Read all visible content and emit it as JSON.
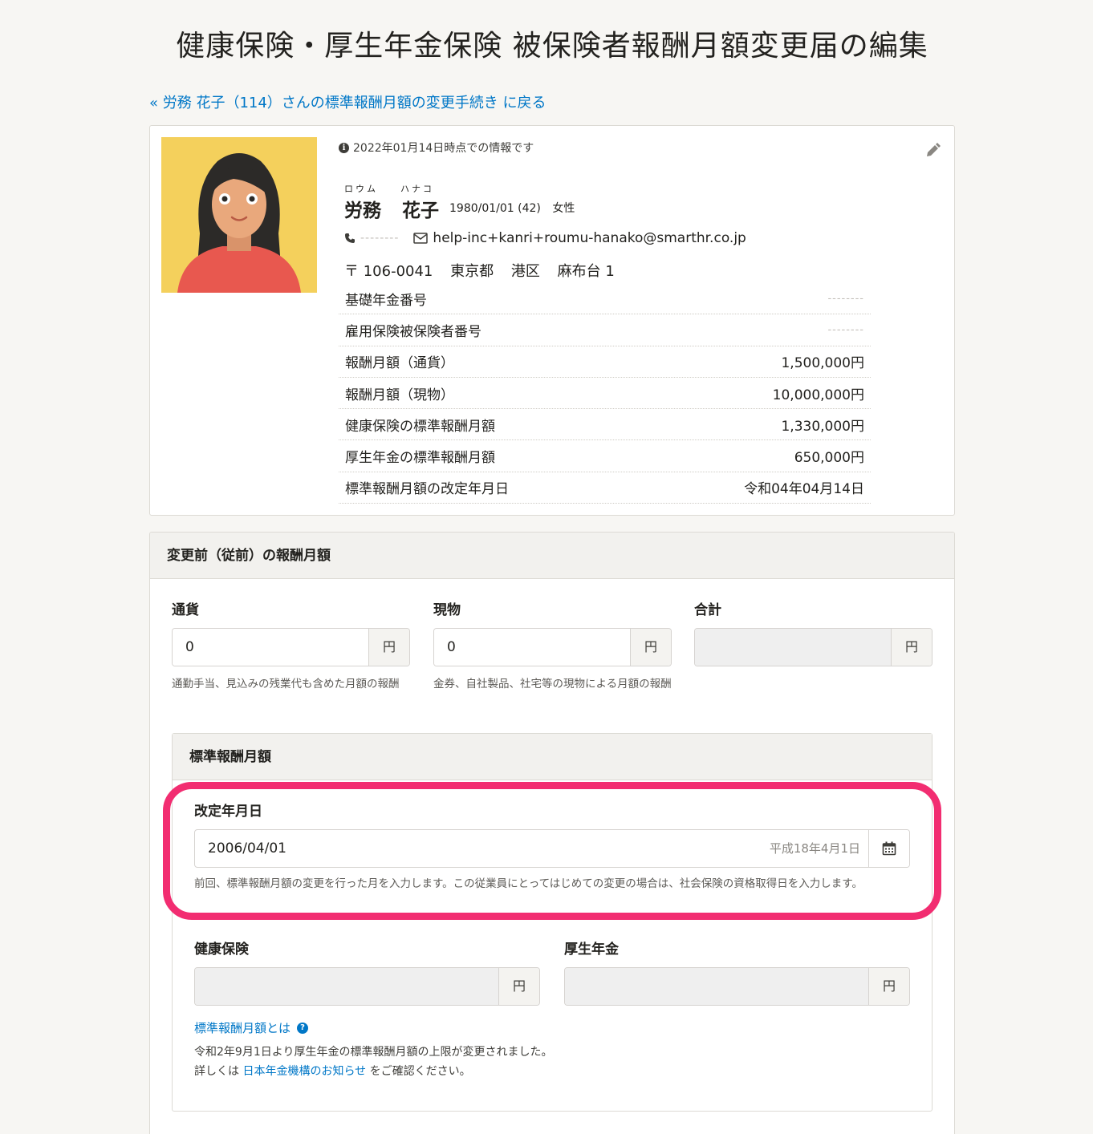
{
  "page_title": "健康保険・厚生年金保険 被保険者報酬月額変更届の編集",
  "back_link": "« 労務 花子（114）さんの標準報酬月額の変更手続き に戻る",
  "profile": {
    "info_note": "2022年01月14日時点での情報です",
    "kana_last": "ロウム",
    "kana_first": "ハナコ",
    "last_name": "労務",
    "first_name": "花子",
    "birth": "1980/01/01 (42)",
    "gender": "女性",
    "phone": "--------",
    "email": "help-inc+kanri+roumu-hanako@smarthr.co.jp",
    "postal": "〒 106-0041",
    "prefecture": "東京都",
    "city": "港区",
    "street": "麻布台 1",
    "rows": [
      {
        "label": "基礎年金番号",
        "value": "--------"
      },
      {
        "label": "雇用保険被保険者番号",
        "value": "--------"
      },
      {
        "label": "報酬月額（通貨）",
        "value": "1,500,000円"
      },
      {
        "label": "報酬月額（現物）",
        "value": "10,000,000円"
      },
      {
        "label": "健康保険の標準報酬月額",
        "value": "1,330,000円"
      },
      {
        "label": "厚生年金の標準報酬月額",
        "value": "650,000円"
      },
      {
        "label": "標準報酬月額の改定年月日",
        "value": "令和04年04月14日"
      }
    ]
  },
  "before_panel": {
    "title": "変更前（従前）の報酬月額",
    "currency_label": "通貨",
    "currency_value": "0",
    "currency_hint": "通勤手当、見込みの残業代も含めた月額の報酬",
    "goods_label": "現物",
    "goods_value": "0",
    "goods_hint": "金券、自社製品、社宅等の現物による月額の報酬",
    "total_label": "合計",
    "total_value": "",
    "unit": "円"
  },
  "standard_panel": {
    "title": "標準報酬月額",
    "revision_label": "改定年月日",
    "revision_value": "2006/04/01",
    "revision_wareki": "平成18年4月1日",
    "revision_hint": "前回、標準報酬月額の変更を行った月を入力します。この従業員にとってはじめての変更の場合は、社会保険の資格取得日を入力します。",
    "health_label": "健康保険",
    "pension_label": "厚生年金",
    "unit": "円",
    "help_link": "標準報酬月額とは",
    "notice_line1": "令和2年9月1日より厚生年金の標準報酬月額の上限が変更されました。",
    "notice_prefix": "詳しくは ",
    "notice_link": "日本年金機構のお知らせ",
    "notice_suffix": " をご確認ください。"
  },
  "colors": {
    "link": "#0077c7",
    "highlight": "#f22d71",
    "avatar_bg": "#f4d05c"
  }
}
